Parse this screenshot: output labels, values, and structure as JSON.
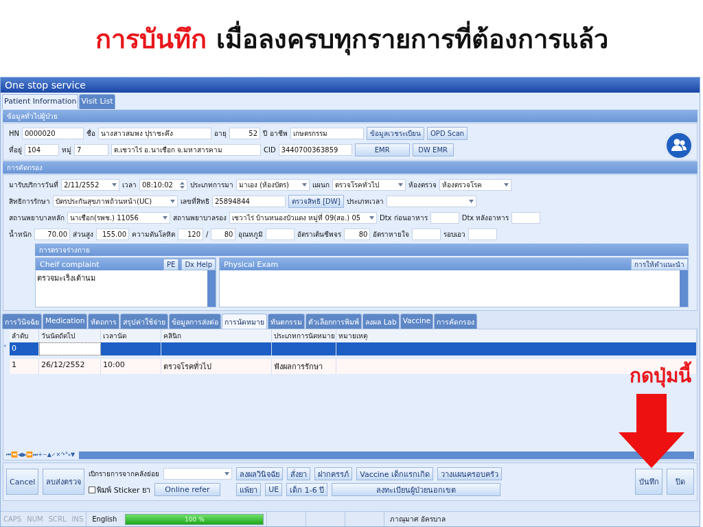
{
  "slide": {
    "title_highlight": "การบันทึก",
    "title_rest": "เมื่อลงครบทุกรายการที่ต้องการแล้ว",
    "callout": "กดปุ่มนี้"
  },
  "window": {
    "title": "One stop service"
  },
  "tabs": [
    {
      "label": "Patient Information",
      "selected": true
    },
    {
      "label": "Visit List",
      "selected": false
    }
  ],
  "patient_section": {
    "title": "ข้อมูลทั่วไปผู้ป่วย",
    "lines": [
      {
        "items": [
          {
            "kind": "label",
            "text": "HN"
          },
          {
            "kind": "field",
            "text": "0000020"
          },
          {
            "kind": "label",
            "text": "ชื่อ"
          },
          {
            "kind": "field",
            "text": "นางสาวสมพง ปุราชะคึง"
          },
          {
            "kind": "label",
            "text": "อายุ"
          },
          {
            "kind": "number",
            "text": "52"
          },
          {
            "kind": "label",
            "text": "ปี"
          },
          {
            "kind": "label",
            "text": "อาชีพ"
          },
          {
            "kind": "field",
            "text": "เกษตรกรรม"
          },
          {
            "kind": "button",
            "text": "ข้อมูลเวชระเบียน"
          },
          {
            "kind": "button",
            "text": "OPD Scan"
          }
        ]
      },
      {
        "items": [
          {
            "kind": "label",
            "text": "ที่อยู่"
          },
          {
            "kind": "field",
            "text": "104"
          },
          {
            "kind": "label",
            "text": "หมู่"
          },
          {
            "kind": "field",
            "text": "7"
          },
          {
            "kind": "field",
            "text": "ต.เชวาไร่ อ.นาเชือก จ.มหาสารคาม"
          },
          {
            "kind": "label",
            "text": "CID"
          },
          {
            "kind": "field",
            "text": "3440700363859"
          },
          {
            "kind": "button",
            "text": "EMR"
          },
          {
            "kind": "button",
            "text": "DW EMR"
          }
        ]
      }
    ]
  },
  "screening_section": {
    "title": "การคัดกรอง",
    "lines": [
      {
        "items": [
          {
            "kind": "label",
            "text": "มารับบริการวันที่"
          },
          {
            "kind": "combo",
            "text": "2/11/2552"
          },
          {
            "kind": "label",
            "text": "เวลา"
          },
          {
            "kind": "time",
            "text": "08:10:02"
          },
          {
            "kind": "label",
            "text": "ประเภทการมา"
          },
          {
            "kind": "combo",
            "text": "มาเอง (ห้องบัตร)"
          },
          {
            "kind": "label",
            "text": "แผนก"
          },
          {
            "kind": "combo",
            "text": "ตรวจโรคทั่วไป"
          },
          {
            "kind": "label",
            "text": "ห้องตรวจ"
          },
          {
            "kind": "combo",
            "text": "ห้องตรวจโรค"
          }
        ]
      },
      {
        "items": [
          {
            "kind": "label",
            "text": "สิทธิการรักษา"
          },
          {
            "kind": "combo",
            "text": "บัตรประกันสุขภาพถ้วนหน้า(UC)"
          },
          {
            "kind": "label",
            "text": "เลขที่สิทธิ"
          },
          {
            "kind": "field",
            "text": "25894844"
          },
          {
            "kind": "button",
            "text": "ตรวจสิทธิ [DW]"
          },
          {
            "kind": "label",
            "text": "ประเภทเวลา"
          },
          {
            "kind": "combo"
          }
        ]
      },
      {
        "items": [
          {
            "kind": "label",
            "text": "สถานพยาบาลหลัก"
          },
          {
            "kind": "combo",
            "text": "นาเชือก(รพช.) 11056"
          },
          {
            "kind": "label",
            "text": "สถานพยาบาลรอง"
          },
          {
            "kind": "combo",
            "text": "เชวาไร่ บ้านหนองบัวแดง หมู่ที่ 09(สอ.) 05"
          },
          {
            "kind": "label",
            "text": "Dtx ก่อนอาหาร"
          },
          {
            "kind": "field"
          },
          {
            "kind": "label",
            "text": "Dtx หลังอาหาร"
          },
          {
            "kind": "field"
          }
        ]
      },
      {
        "items": [
          {
            "kind": "label",
            "text": "น้ำหนัก"
          },
          {
            "kind": "number",
            "text": "70.00"
          },
          {
            "kind": "label",
            "text": "ส่วนสูง"
          },
          {
            "kind": "number",
            "text": "155.00"
          },
          {
            "kind": "label",
            "text": "ความดันโลหิต"
          },
          {
            "kind": "number",
            "text": "120"
          },
          {
            "kind": "label",
            "text": "/"
          },
          {
            "kind": "number",
            "text": "80"
          },
          {
            "kind": "label",
            "text": "อุณหภูมิ"
          },
          {
            "kind": "field"
          },
          {
            "kind": "label",
            "text": "อัตราเต้นชีพจร"
          },
          {
            "kind": "number",
            "text": "80"
          },
          {
            "kind": "label",
            "text": "อัตราหายใจ"
          },
          {
            "kind": "field"
          },
          {
            "kind": "label",
            "text": "รอบเอว"
          },
          {
            "kind": "field"
          }
        ]
      }
    ],
    "exam": {
      "title": "การตรวจร่างกาย",
      "complaint": {
        "title": "Cheif complaint",
        "buttons": [
          "PE",
          "Dx Help"
        ],
        "text": "ตรวจมะเร็งเต้านม"
      },
      "physical": {
        "title": "Physical Exam",
        "buttons": [
          "การให้คำแนะนำ"
        ]
      }
    }
  },
  "lower_tabs": [
    {
      "label": "การวินิจฉัย",
      "selected": false
    },
    {
      "label": "Medication",
      "selected": false
    },
    {
      "label": "หัตถการ",
      "selected": false
    },
    {
      "label": "สรุปค่าใช้จ่าย",
      "selected": false
    },
    {
      "label": "ข้อมูลการส่งต่อ",
      "selected": false
    },
    {
      "label": "การนัดหมาย",
      "selected": true
    },
    {
      "label": "ทันตกรรม",
      "selected": false
    },
    {
      "label": "ตัวเลือกการพิมพ์",
      "selected": false
    },
    {
      "label": "ลงผล Lab",
      "selected": false
    },
    {
      "label": "Vaccine",
      "selected": false
    },
    {
      "label": "การคัดกรอง",
      "selected": false
    }
  ],
  "table": {
    "columns": [
      "ลำดับ",
      "วันนัดถัดไป",
      "เวลานัด",
      "คลินิก",
      "ประเภทการนัดหมาย",
      "หมายเหตุ"
    ],
    "rows": [
      {
        "marker": "*",
        "selected": true,
        "cells": [
          "0",
          "",
          "",
          "",
          "",
          ""
        ]
      },
      {
        "selected": false,
        "cells": [
          "1",
          "26/12/2552",
          "10:00",
          "ตรวจโรคทั่วไป",
          "ฟังผลการรักษา",
          ""
        ]
      }
    ],
    "navigator": [
      "⏮",
      "⏪",
      "◀",
      "▶",
      "⏩",
      "⏭",
      "+",
      "−",
      "▲",
      "✓",
      "✕",
      "↷",
      "*",
      "⁎",
      "▼"
    ]
  },
  "bottom_bar": {
    "left_buttons": [
      "Cancel",
      "ลบส่งตรวจ"
    ],
    "stock_label": "เบิกรายการจากคลังย่อย",
    "sticker": {
      "label": "พิมพ์ Sticker ยา",
      "checked": false
    },
    "online_refer": "Online refer",
    "buttons_row1": [
      "ลงผลวินิจฉัย",
      "สั่งยา",
      "ฝากครรภ์",
      "Vaccine เด็กแรกเกิด",
      "วางแผนครอบครัว"
    ],
    "buttons_row2": [
      "แพ้ยา",
      "UE",
      "เด็ก 1-6 ปี",
      "ลงทะเบียนผู้ป่วยนอกเขต"
    ],
    "right_buttons": [
      "บันทึก",
      "ปิด"
    ]
  },
  "status_bar": {
    "keys": [
      {
        "label": "CAPS",
        "disabled": true
      },
      {
        "label": "NUM",
        "disabled": true
      },
      {
        "label": "SCRL",
        "disabled": true
      },
      {
        "label": "INS",
        "disabled": true
      }
    ],
    "language": "English",
    "progress": {
      "level": 1,
      "text": "100 %"
    },
    "user": "ภาณุมาศ อัครบาล"
  }
}
